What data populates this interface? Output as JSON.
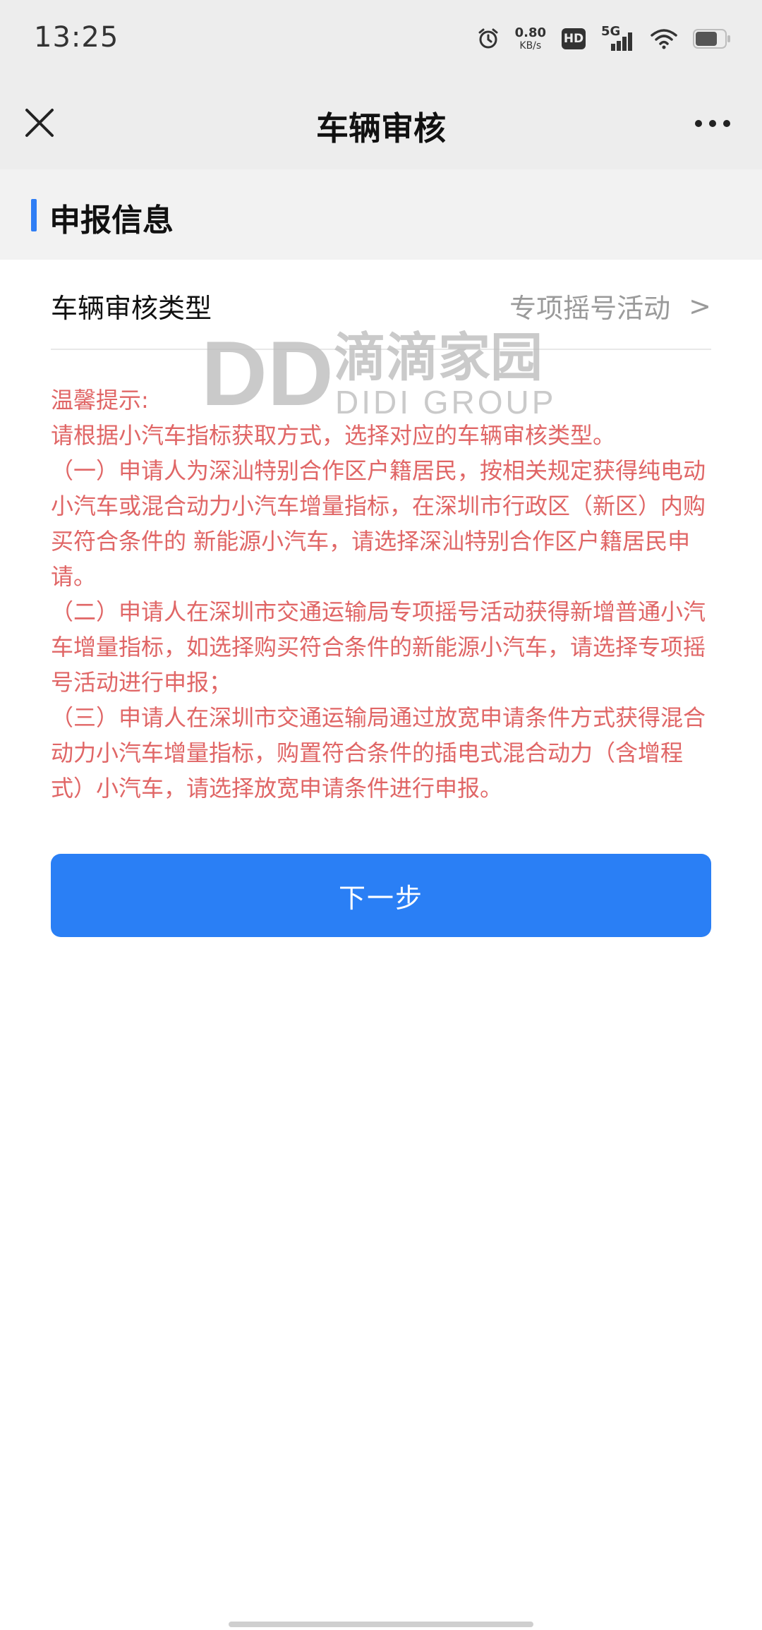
{
  "status_bar": {
    "time": "13:25",
    "speed_value": "0.80",
    "speed_unit": "KB/s",
    "hd_label": "HD",
    "network_label": "5G"
  },
  "nav": {
    "title": "车辆审核",
    "close_icon": "close-icon",
    "more_icon": "more-icon"
  },
  "section": {
    "title": "申报信息",
    "accent_color": "#2f7ef5"
  },
  "form": {
    "type_label": "车辆审核类型",
    "type_value": "专项摇号活动",
    "chevron": ">"
  },
  "notice": {
    "color": "#e06666",
    "text": "温馨提示:\n请根据小汽车指标获取方式，选择对应的车辆审核类型。\n（一）申请人为深汕特别合作区户籍居民，按相关规定获得纯电动小汽车或混合动力小汽车增量指标，在深圳市行政区（新区）内购买符合条件的 新能源小汽车，请选择深汕特别合作区户籍居民申请。\n（二）申请人在深圳市交通运输局专项摇号活动获得新增普通小汽车增量指标，如选择购买符合条件的新能源小汽车，请选择专项摇号活动进行申报；\n（三）申请人在深圳市交通运输局通过放宽申请条件方式获得混合动力小汽车增量指标，购置符合条件的插电式混合动力（含增程式）小汽车，请选择放宽申请条件进行申报。"
  },
  "watermark": {
    "logo_text": "DD",
    "cn_text": "滴滴家园",
    "en_text": "DIDI GROUP"
  },
  "button": {
    "next_label": "下一步",
    "color": "#2a7ff5"
  }
}
